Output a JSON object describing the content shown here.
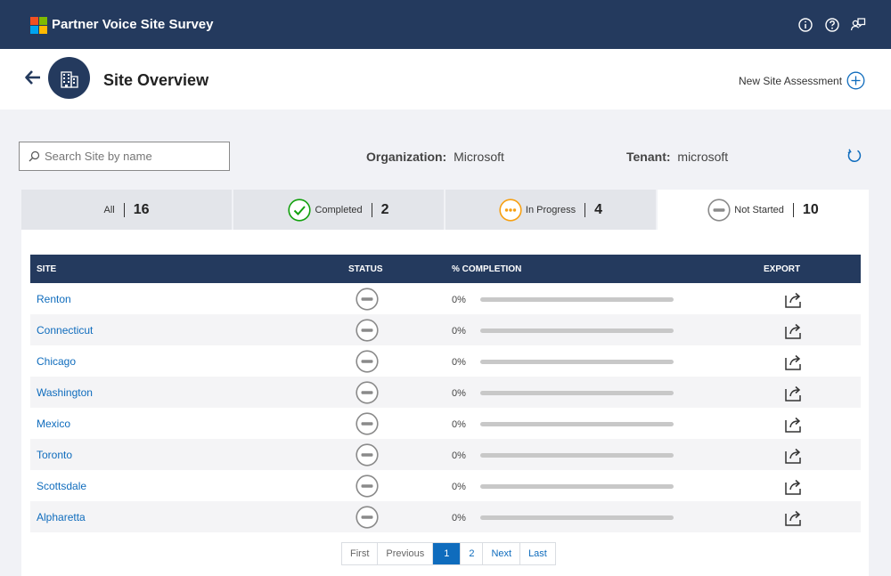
{
  "app": {
    "title": "Partner Voice Site Survey",
    "logo_colors": [
      "#f25022",
      "#7fba00",
      "#00a4ef",
      "#ffb900"
    ]
  },
  "header_icons": [
    "info-icon",
    "help-icon",
    "feedback-icon"
  ],
  "page": {
    "title": "Site Overview",
    "new_assessment_label": "New Site Assessment"
  },
  "filters": {
    "search_placeholder": "Search Site by name",
    "organization_label": "Organization:",
    "organization_value": "Microsoft",
    "tenant_label": "Tenant:",
    "tenant_value": "microsoft"
  },
  "tabs": [
    {
      "label": "All",
      "count": "16",
      "icon": ""
    },
    {
      "label": "Completed",
      "count": "2",
      "icon": "check-circle-icon"
    },
    {
      "label": "In Progress",
      "count": "4",
      "icon": "in-progress-icon"
    },
    {
      "label": "Not Started",
      "count": "10",
      "icon": "not-started-icon"
    }
  ],
  "table": {
    "headers": [
      "SITE",
      "STATUS",
      "% COMPLETION",
      "EXPORT"
    ],
    "rows": [
      {
        "site": "Renton",
        "status": "Not Started",
        "completion_text": "0%",
        "completion": 0
      },
      {
        "site": "Connecticut",
        "status": "Not Started",
        "completion_text": "0%",
        "completion": 0
      },
      {
        "site": "Chicago",
        "status": "Not Started",
        "completion_text": "0%",
        "completion": 0
      },
      {
        "site": "Washington",
        "status": "Not Started",
        "completion_text": "0%",
        "completion": 0
      },
      {
        "site": "Mexico",
        "status": "Not Started",
        "completion_text": "0%",
        "completion": 0
      },
      {
        "site": "Toronto",
        "status": "Not Started",
        "completion_text": "0%",
        "completion": 0
      },
      {
        "site": "Scottsdale",
        "status": "Not Started",
        "completion_text": "0%",
        "completion": 0
      },
      {
        "site": "Alpharetta",
        "status": "Not Started",
        "completion_text": "0%",
        "completion": 0
      }
    ]
  },
  "pagination": {
    "first": "First",
    "previous": "Previous",
    "pages": [
      "1",
      "2"
    ],
    "current": "1",
    "next": "Next",
    "last": "Last"
  },
  "colors": {
    "brand_navy": "#243a5e",
    "link_blue": "#0f6cbd",
    "completed_green": "#13a10e",
    "in_progress_orange": "#f7a012",
    "not_started_gray": "#8a8a8a"
  }
}
